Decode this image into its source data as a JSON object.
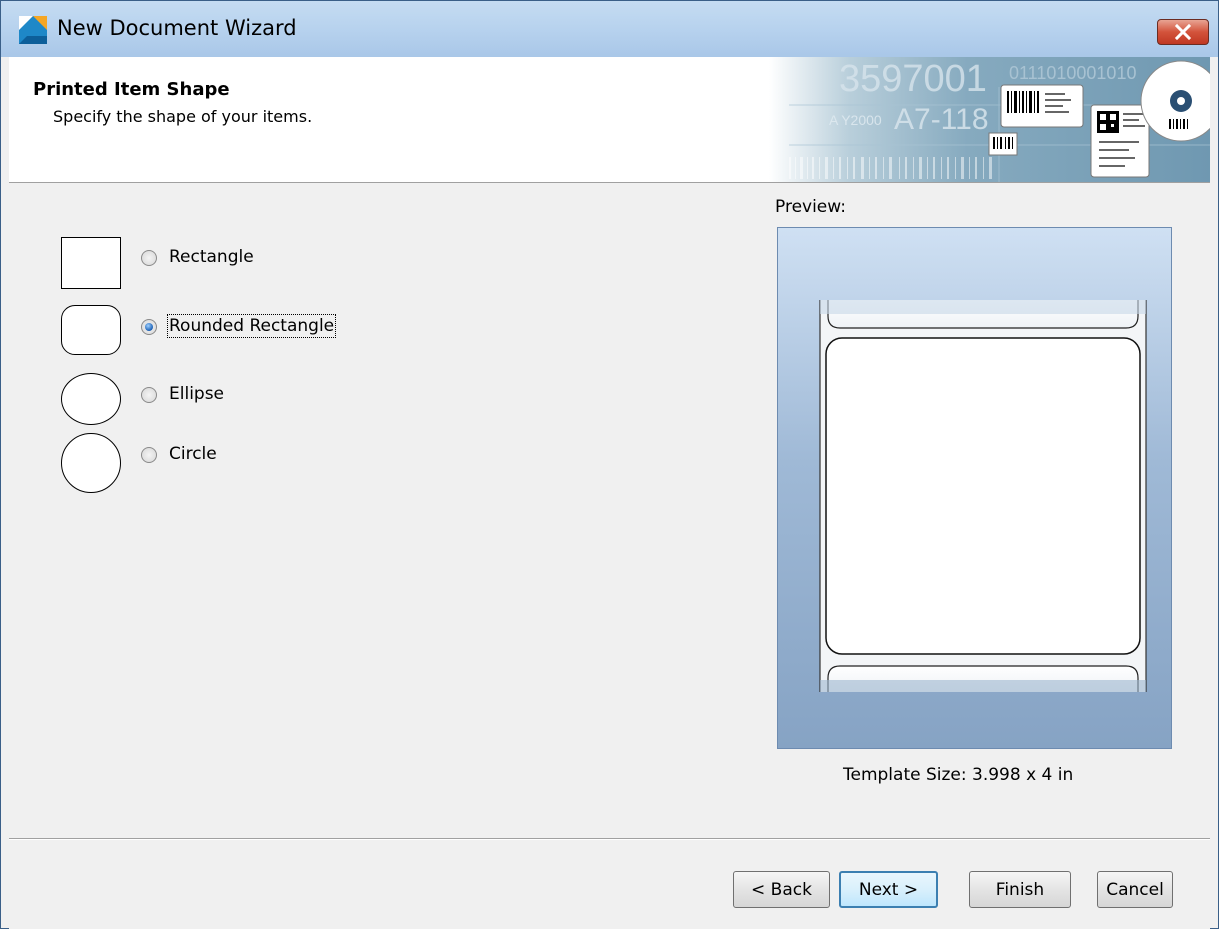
{
  "window": {
    "title": "New Document Wizard"
  },
  "header": {
    "title": "Printed Item Shape",
    "subtitle": "Specify the shape of your items."
  },
  "shapes": [
    {
      "label": "Rectangle",
      "checked": false
    },
    {
      "label": "Rounded Rectangle",
      "checked": true
    },
    {
      "label": "Ellipse",
      "checked": false
    },
    {
      "label": "Circle",
      "checked": false
    }
  ],
  "preview": {
    "label": "Preview:",
    "template_size": "Template Size:  3.998 x 4 in"
  },
  "buttons": {
    "back": "< Back",
    "next": "Next >",
    "finish": "Finish",
    "cancel": "Cancel"
  },
  "banner": {
    "numbers": "3597001",
    "code": "A7-118",
    "bits": "0111010001010",
    "year": "A Y2000"
  },
  "colors": {
    "titlebar": "#b7d2ee",
    "close": "#c8432c",
    "accent": "#3c7fb1",
    "banner_bg": "#7ea6bf"
  }
}
